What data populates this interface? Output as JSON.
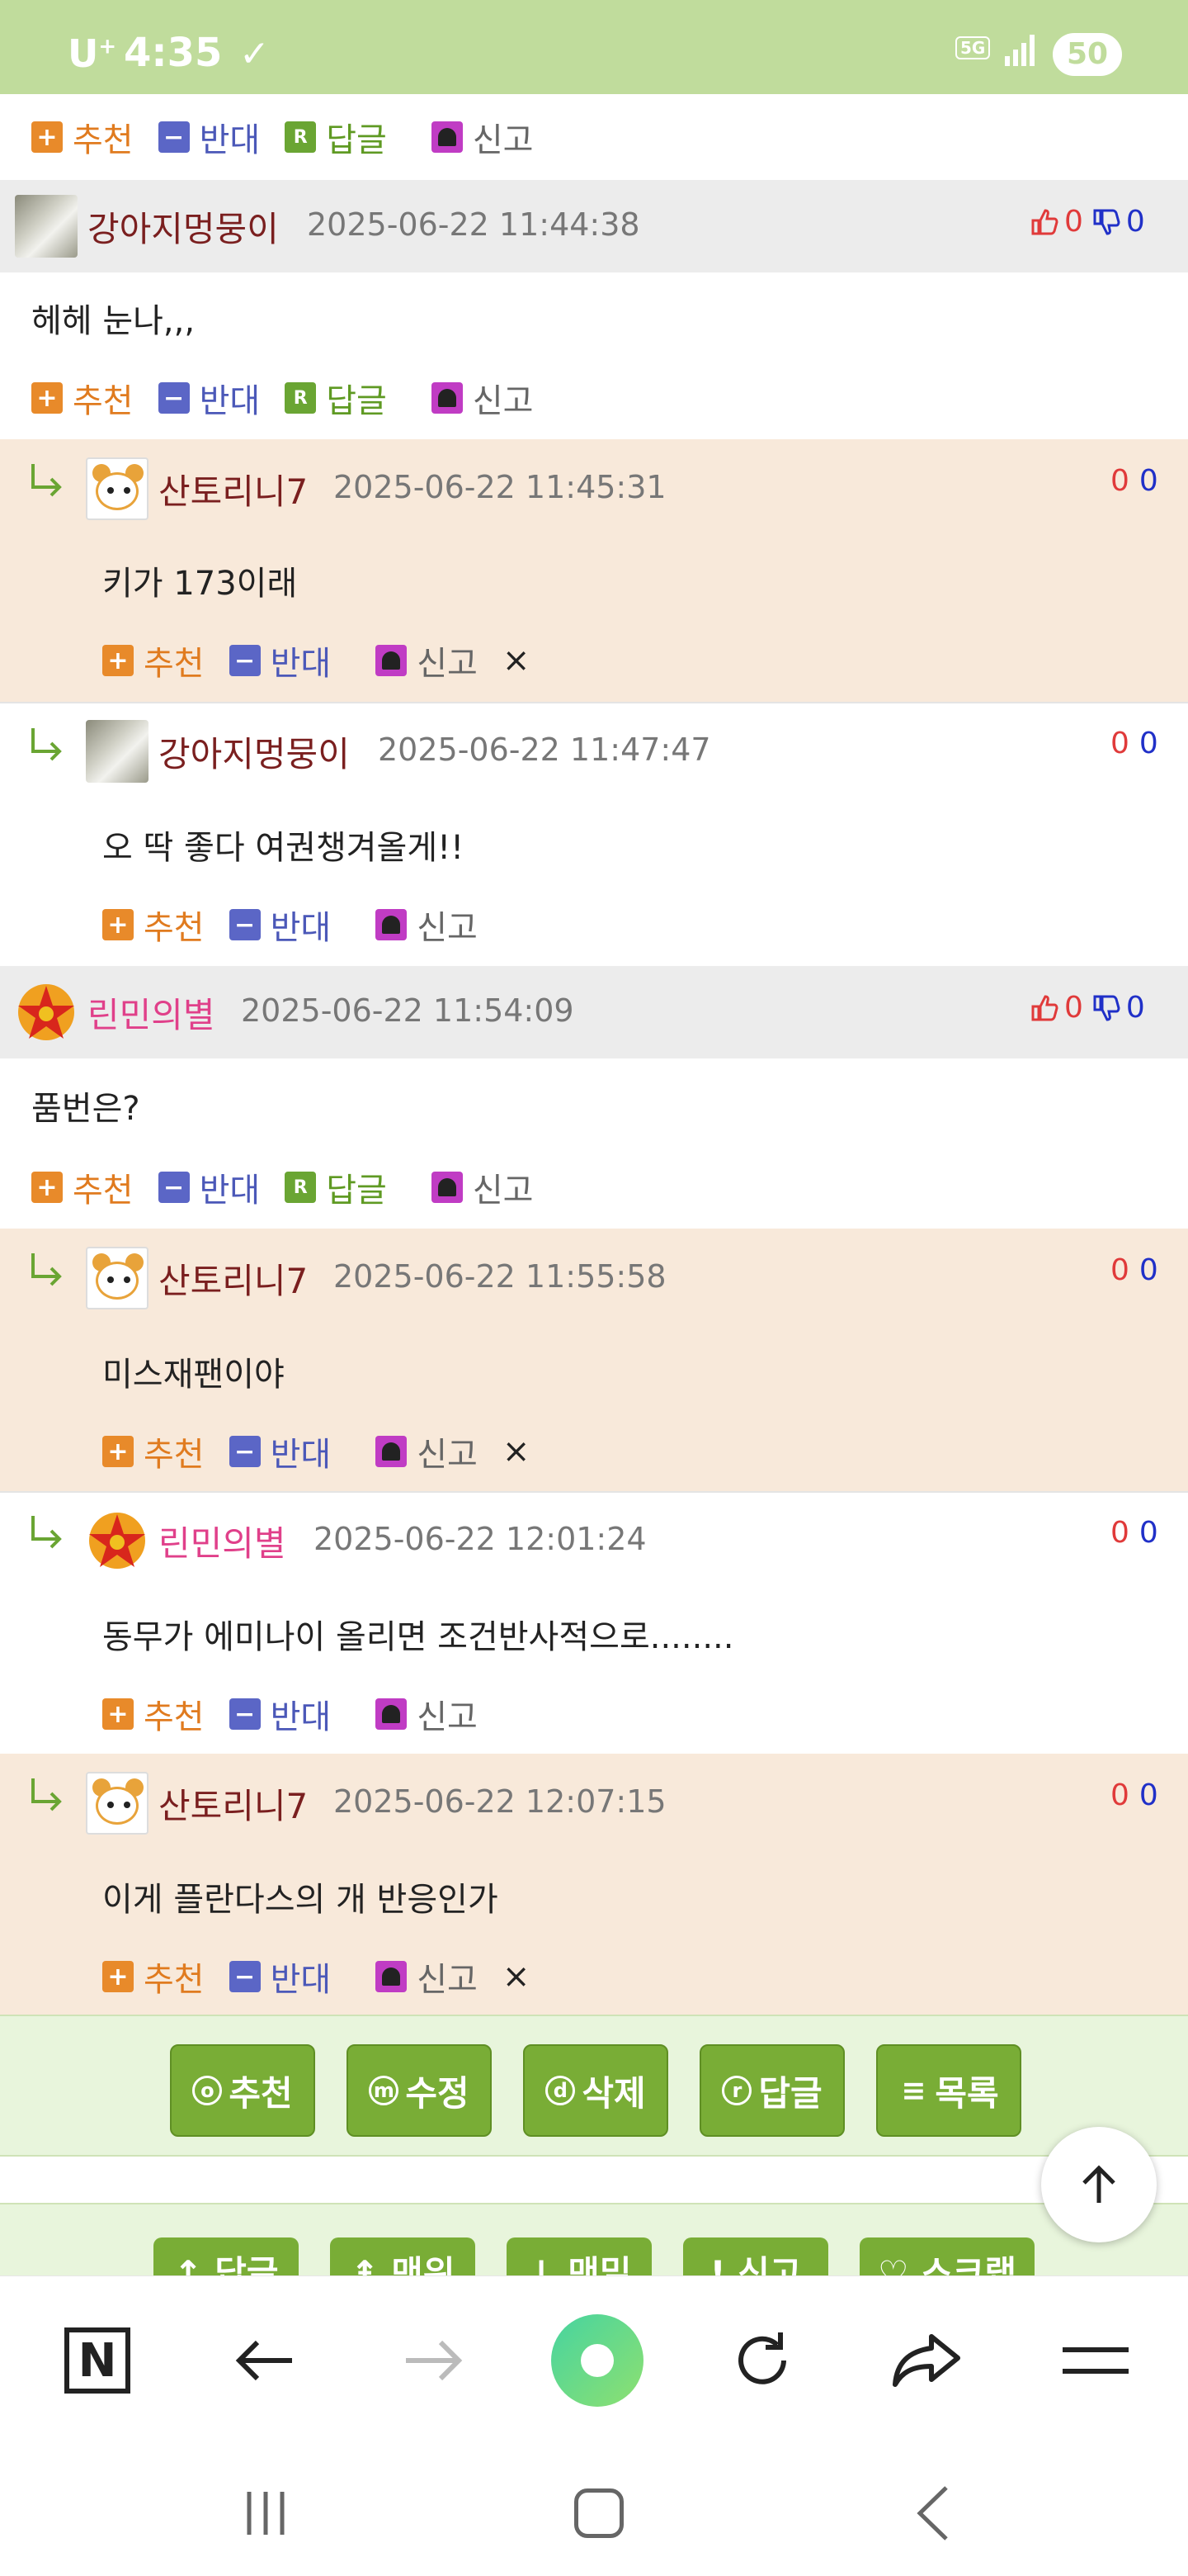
{
  "status_bar": {
    "carrier": "U",
    "carrier_sup": "+",
    "time": "4:35",
    "network": "5G",
    "battery": "50"
  },
  "action_labels": {
    "recommend": "추천",
    "oppose": "반대",
    "reply": "답글",
    "report": "신고",
    "reply_icon_letter": "R",
    "recommend_icon": "+",
    "oppose_icon": "−",
    "delete_icon": "×"
  },
  "comments": [
    {
      "nick": "강아지멍뭉이",
      "date": "2025-06-22 11:44:38",
      "up": "0",
      "down": "0",
      "body": "헤헤 눈나,,,"
    },
    {
      "nick": "산토리니7",
      "date": "2025-06-22 11:45:31",
      "up": "0",
      "down": "0",
      "body": "키가 173이래"
    },
    {
      "nick": "강아지멍뭉이",
      "date": "2025-06-22 11:47:47",
      "up": "0",
      "down": "0",
      "body": "오 딱 좋다 여권챙겨올게!!"
    },
    {
      "nick": "린민의별",
      "date": "2025-06-22 11:54:09",
      "up": "0",
      "down": "0",
      "body": "품번은?"
    },
    {
      "nick": "산토리니7",
      "date": "2025-06-22 11:55:58",
      "up": "0",
      "down": "0",
      "body": "미스재팬이야"
    },
    {
      "nick": "린민의별",
      "date": "2025-06-22 12:01:24",
      "up": "0",
      "down": "0",
      "body": "동무가 에미나이 올리면 조건반사적으로........"
    },
    {
      "nick": "산토리니7",
      "date": "2025-06-22 12:07:15",
      "up": "0",
      "down": "0",
      "body": "이게 플란다스의 개 반응인가"
    }
  ],
  "bottom_buttons": [
    {
      "icon": "o",
      "label": "추천"
    },
    {
      "icon": "m",
      "label": "수정"
    },
    {
      "icon": "d",
      "label": "삭제"
    },
    {
      "icon": "r",
      "label": "답글"
    },
    {
      "icon": "≡",
      "label": "목록"
    }
  ],
  "bottom_buttons_2": [
    "↑ 답글",
    "⇞ 맨위",
    "↓ 맨밑",
    "! 신고",
    "♡ 스크랩"
  ],
  "browser_toolbar": {
    "naver_letter": "N"
  },
  "colors": {
    "status_bar": "#c0dc9c",
    "reply_bg": "#f8e9da",
    "button_green": "#79ad36",
    "recommend": "#e07b1f",
    "oppose": "#4b58b8",
    "reply": "#5f9a23"
  }
}
